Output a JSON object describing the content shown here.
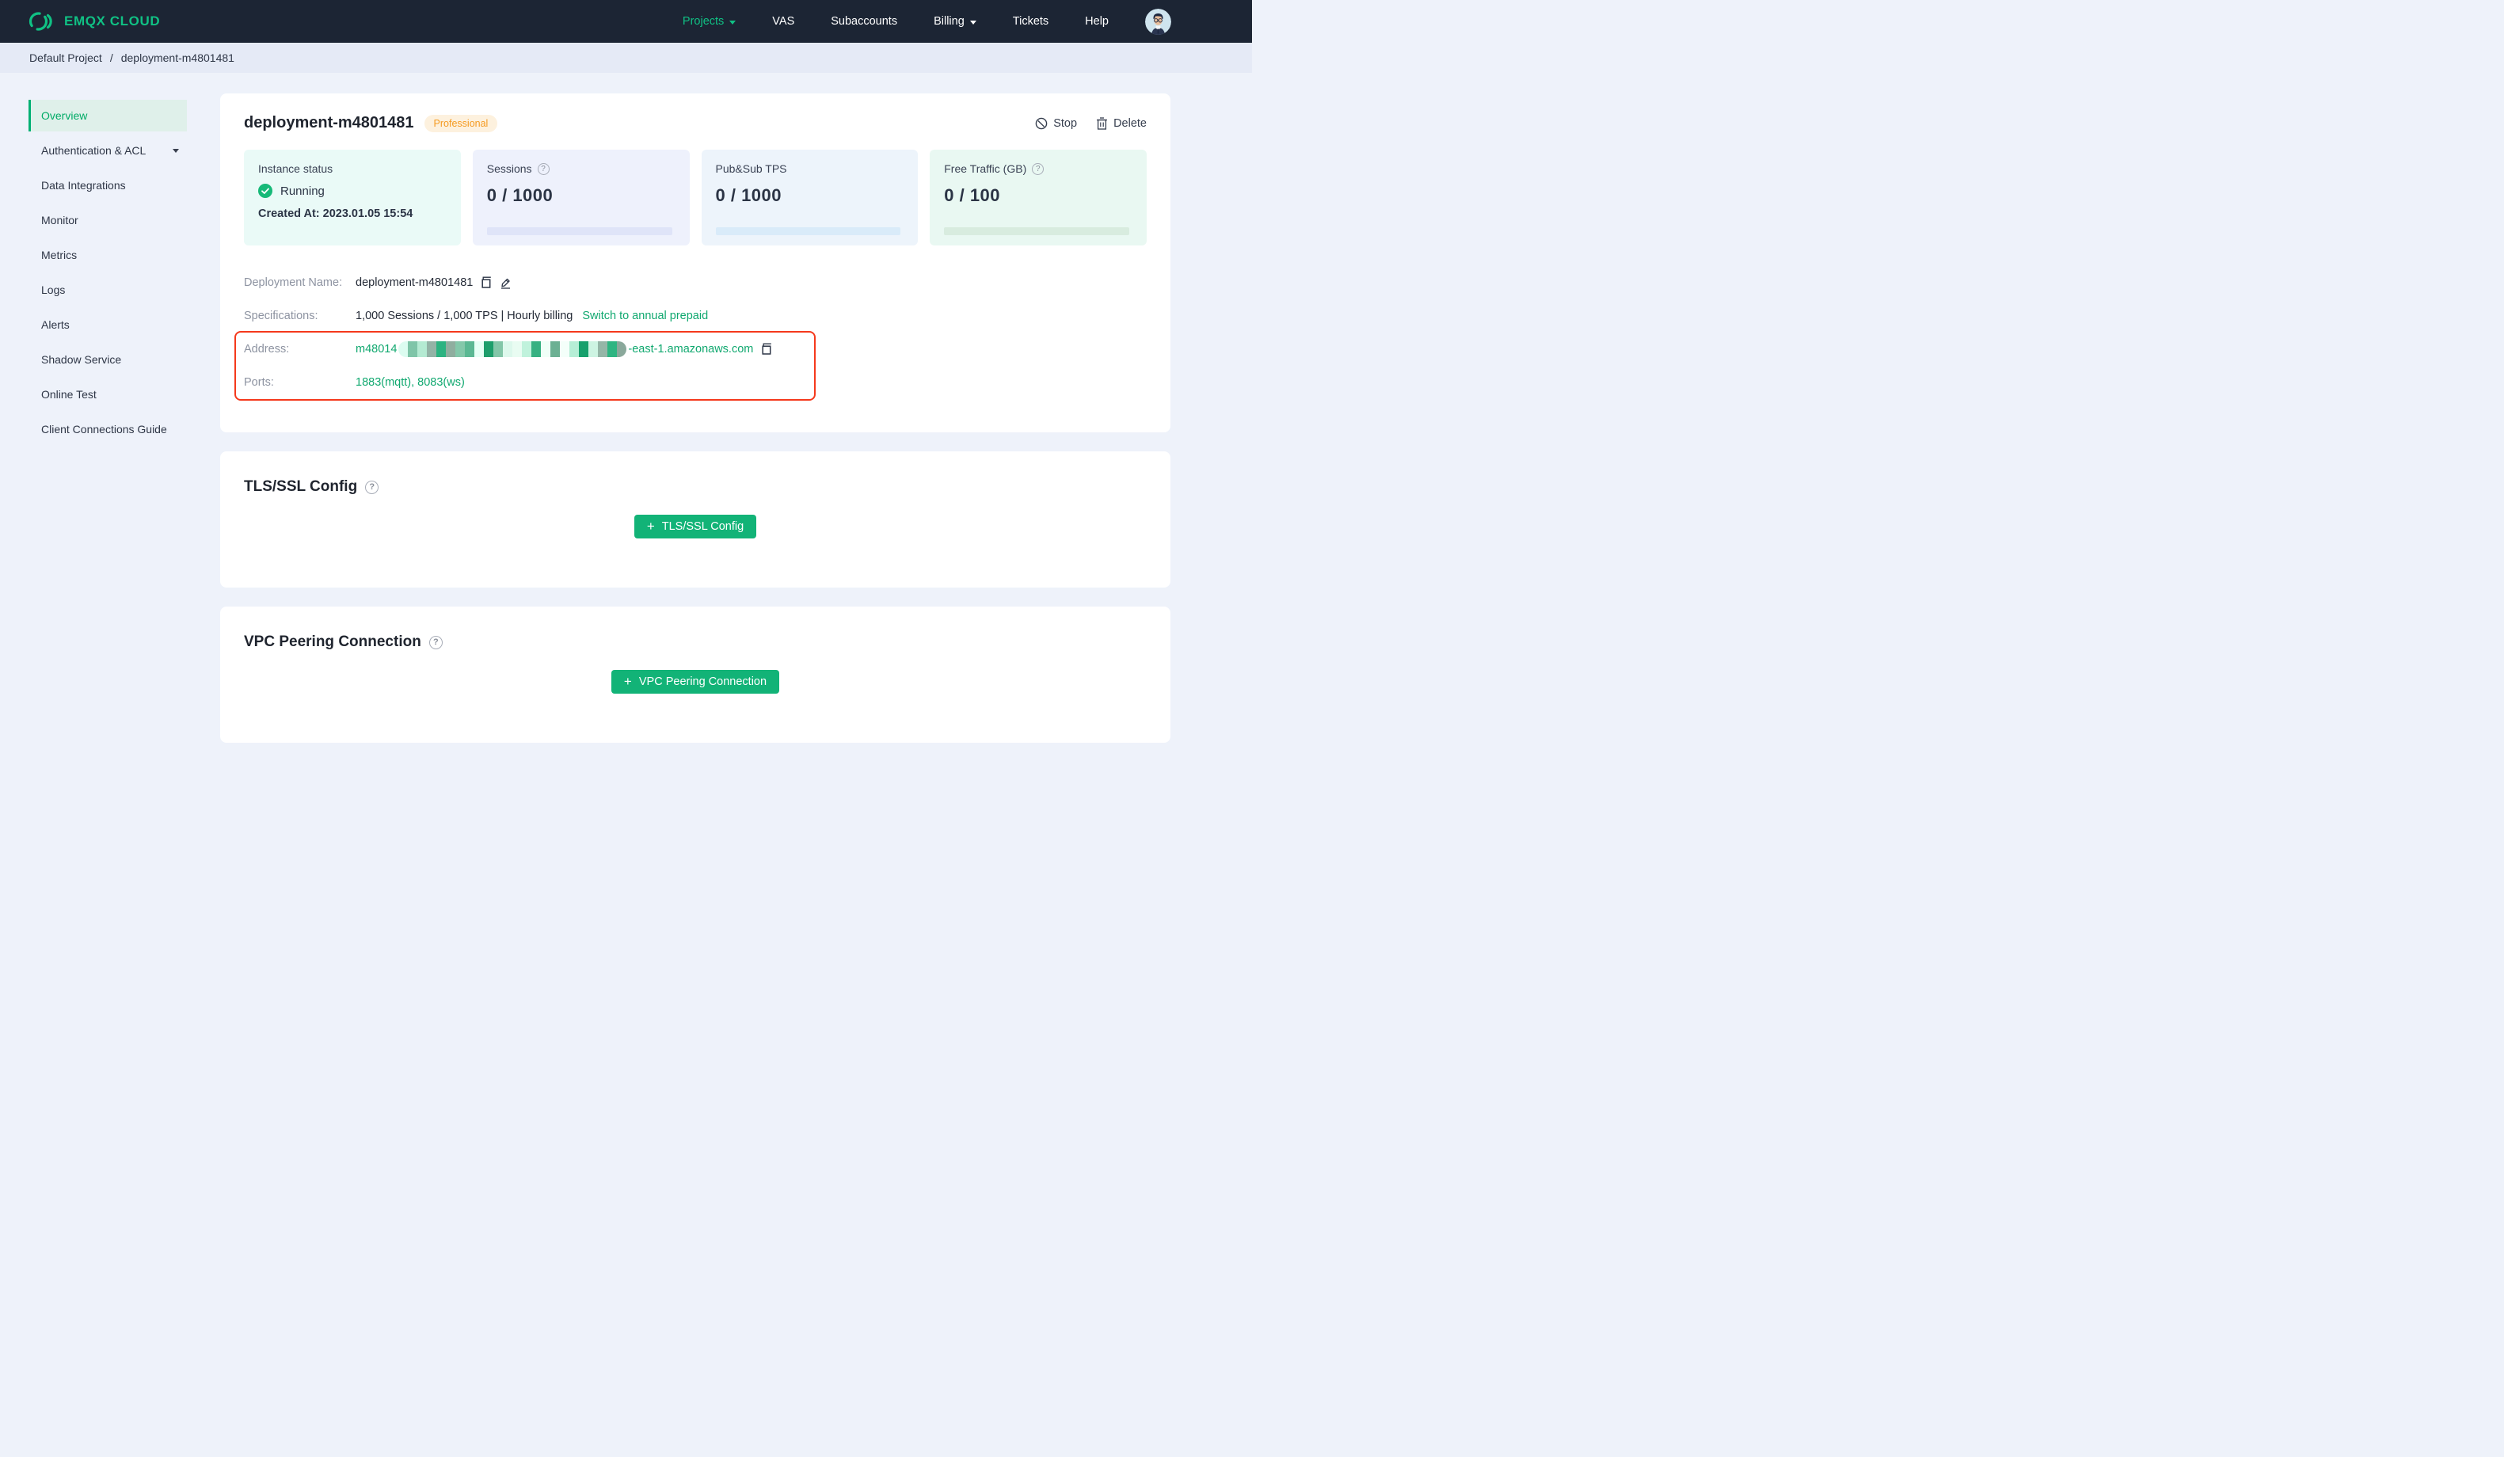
{
  "navbar": {
    "brand": "EMQX CLOUD",
    "items": [
      {
        "label": "Projects"
      },
      {
        "label": "VAS"
      },
      {
        "label": "Subaccounts"
      },
      {
        "label": "Billing"
      },
      {
        "label": "Tickets"
      },
      {
        "label": "Help"
      }
    ]
  },
  "breadcrumb": {
    "project": "Default Project",
    "separator": "/",
    "page": "deployment-m4801481"
  },
  "sidebar": {
    "items": [
      {
        "label": "Overview"
      },
      {
        "label": "Authentication & ACL"
      },
      {
        "label": "Data Integrations"
      },
      {
        "label": "Monitor"
      },
      {
        "label": "Metrics"
      },
      {
        "label": "Logs"
      },
      {
        "label": "Alerts"
      },
      {
        "label": "Shadow Service"
      },
      {
        "label": "Online Test"
      },
      {
        "label": "Client Connections Guide"
      }
    ]
  },
  "overview": {
    "title": "deployment-m4801481",
    "plan_badge": "Professional",
    "stop_label": "Stop",
    "delete_label": "Delete",
    "status_cards": {
      "instance": {
        "label": "Instance status",
        "status": "Running",
        "created_at": "Created At: 2023.01.05 15:54"
      },
      "sessions": {
        "label": "Sessions",
        "value": "0 / 1000"
      },
      "tps": {
        "label": "Pub&Sub TPS",
        "value": "0 / 1000"
      },
      "traffic": {
        "label": "Free Traffic (GB)",
        "value": "0 / 100"
      }
    },
    "info": {
      "deployment_name_label": "Deployment Name:",
      "deployment_name": "deployment-m4801481",
      "specifications_label": "Specifications:",
      "specifications": "1,000 Sessions / 1,000 TPS | Hourly billing",
      "switch_link": "Switch to annual prepaid",
      "address_label": "Address:",
      "address_prefix": "m48014",
      "address_suffix": "-east-1.amazonaws.com",
      "redaction_colors": [
        "#dcfcf0",
        "#7fc5a8",
        "#b4ead2",
        "#93b3a6",
        "#2cb381",
        "#8fae9f",
        "#84c8aa",
        "#5bb893",
        "#e6fff5",
        "#1d9e6b",
        "#83c6a8",
        "#ddf8ec",
        "#e9fcf2",
        "#c0f2dc",
        "#37b182",
        "#f0fff8",
        "#6cb093",
        "#f4fffa",
        "#b6eed6",
        "#17a06c",
        "#cdf4e2",
        "#95b6a7",
        "#2fb582",
        "#8aa89b"
      ],
      "ports_label": "Ports:",
      "ports": "1883(mqtt), 8083(ws)"
    }
  },
  "tls_section": {
    "title": "TLS/SSL Config",
    "button_label": "TLS/SSL Config"
  },
  "vpc_section": {
    "title": "VPC Peering Connection",
    "button_label": "VPC Peering Connection"
  },
  "colors": {
    "brand_green": "#10c184",
    "button_green": "#12b377",
    "running_green": "#16b978",
    "badge_orange": "#f59b22",
    "annotation_red": "#f5391c",
    "navbar_bg": "#1c2534"
  }
}
